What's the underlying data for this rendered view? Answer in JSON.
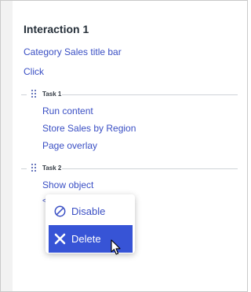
{
  "interaction": {
    "title": "Interaction 1",
    "target": "Category Sales title bar",
    "trigger": "Click"
  },
  "tasks": [
    {
      "label": "Task 1",
      "actions": [
        "Run content",
        "Store Sales by Region",
        "Page overlay"
      ]
    },
    {
      "label": "Task 2",
      "actions": [
        "Show object"
      ]
    }
  ],
  "context_menu": {
    "items": [
      {
        "label": "Disable",
        "icon": "disable-circle-icon"
      },
      {
        "label": "Delete",
        "icon": "close-x-icon",
        "selected": true
      }
    ]
  },
  "colors": {
    "link": "#3a4fc4",
    "selected_bg": "#3754d6",
    "title": "#26303a"
  }
}
